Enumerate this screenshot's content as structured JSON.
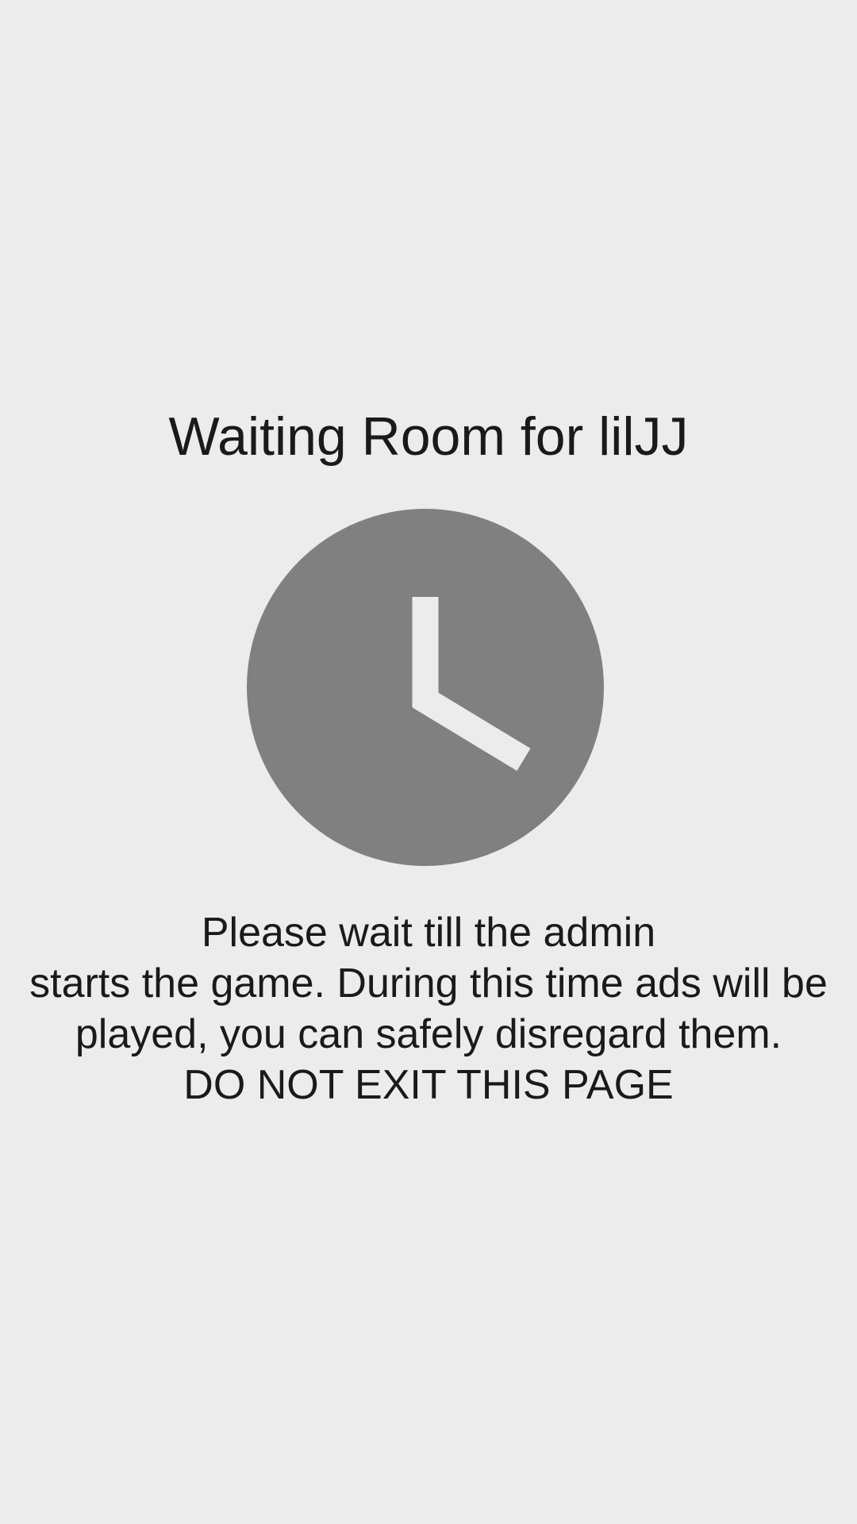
{
  "waiting_room": {
    "title": "Waiting Room for lilJJ",
    "icon": "clock-icon",
    "message_lines": [
      "Please wait till the admin",
      "starts the game. During this time ads will be",
      "played, you can safely disregard them.",
      "DO NOT EXIT THIS PAGE"
    ]
  },
  "colors": {
    "background": "#ECECEC",
    "clock_face": "#808080",
    "clock_hands": "#ECECEC",
    "text": "#1A1A1A"
  }
}
